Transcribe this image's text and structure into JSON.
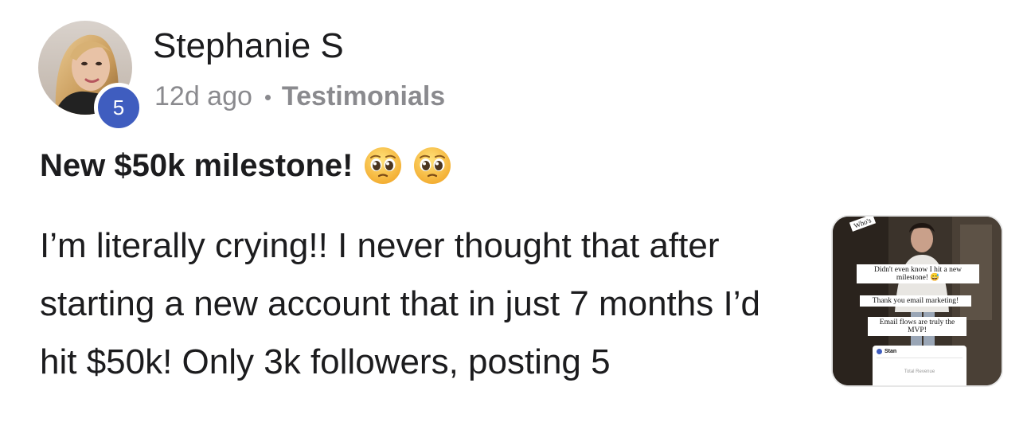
{
  "post": {
    "author": {
      "name": "Stephanie S",
      "level": "5"
    },
    "meta": {
      "time_ago": "12d ago",
      "category": "Testimonials"
    },
    "title": "New $50k milestone!",
    "title_emojis": [
      "pleading-face-emoji",
      "pleading-face-emoji"
    ],
    "body": "I’m literally crying!! I never thought that after starting a new account that in just 7 months I’d hit $50k! Only 3k followers, posting 5",
    "attachment": {
      "corner_tag": "Who's",
      "caption_1": "Didn't even know I hit a new milestone! 😅",
      "caption_2": "Thank you email marketing!",
      "caption_3": "Email flows are truly the MVP!",
      "card_brand": "Stan",
      "card_subtitle": "Total Revenue"
    }
  },
  "colors": {
    "badge": "#3f5dbf",
    "meta_text": "#8a8a8e",
    "text": "#1c1c1e"
  }
}
